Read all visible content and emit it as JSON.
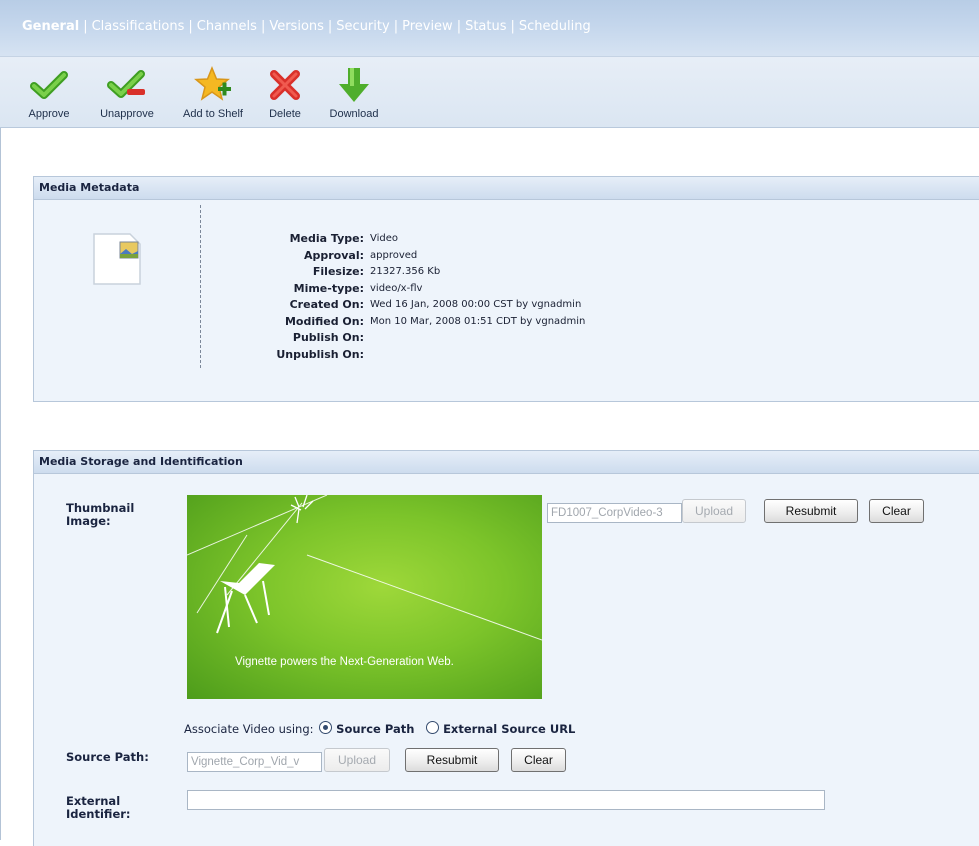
{
  "tabs": [
    {
      "label": "General",
      "active": true
    },
    {
      "label": "Classifications"
    },
    {
      "label": "Channels"
    },
    {
      "label": "Versions"
    },
    {
      "label": "Security"
    },
    {
      "label": "Preview"
    },
    {
      "label": "Status"
    },
    {
      "label": "Scheduling"
    }
  ],
  "toolbar": {
    "approve": "Approve",
    "unapprove": "Unapprove",
    "add_to_shelf": "Add to Shelf",
    "delete": "Delete",
    "download": "Download"
  },
  "metadata": {
    "title": "Media Metadata",
    "rows": [
      {
        "label": "Media Type:",
        "value": "Video"
      },
      {
        "label": "Approval:",
        "value": "approved"
      },
      {
        "label": "Filesize:",
        "value": "21327.356 Kb"
      },
      {
        "label": "Mime-type:",
        "value": "video/x-flv"
      },
      {
        "label": "Created On:",
        "value": "Wed 16 Jan, 2008 00:00 CST by vgnadmin"
      },
      {
        "label": "Modified On:",
        "value": "Mon 10 Mar, 2008 01:51 CDT by vgnadmin"
      },
      {
        "label": "Publish On:",
        "value": ""
      },
      {
        "label": "Unpublish On:",
        "value": ""
      }
    ]
  },
  "storage": {
    "title": "Media Storage and Identification",
    "thumbnail_label_1": "Thumbnail",
    "thumbnail_label_2": "Image:",
    "thumbnail_caption": "Vignette powers the Next-Generation Web.",
    "thumbnail_file": "FD1007_CorpVideo-3",
    "upload": "Upload",
    "resubmit": "Resubmit",
    "clear": "Clear",
    "associate_label": "Associate Video using:",
    "radio_source": "Source Path",
    "radio_external": "External Source URL",
    "source_path_label": "Source Path:",
    "source_path_value": "Vignette_Corp_Vid_v",
    "external_label_1": "External",
    "external_label_2": "Identifier:",
    "external_value": ""
  },
  "colors": {
    "tab_bar": "#c4d6ec",
    "panel_bg": "#eef4fb",
    "thumb_green": "#7cc42a"
  }
}
